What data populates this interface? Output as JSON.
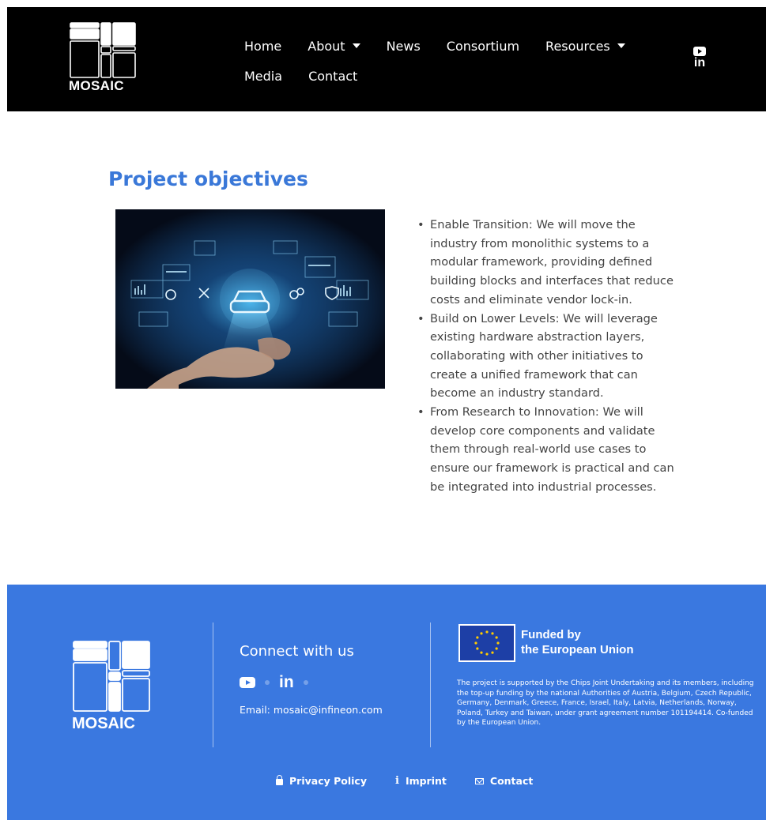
{
  "header": {
    "logo_text": "MOSAIC",
    "nav": [
      {
        "label": "Home",
        "has_dropdown": false
      },
      {
        "label": "About",
        "has_dropdown": true
      },
      {
        "label": "News",
        "has_dropdown": false
      },
      {
        "label": "Consortium",
        "has_dropdown": false
      },
      {
        "label": "Resources",
        "has_dropdown": true
      },
      {
        "label": "Media",
        "has_dropdown": false
      },
      {
        "label": "Contact",
        "has_dropdown": false
      }
    ],
    "social": {
      "youtube_icon": "youtube-icon",
      "linkedin_label": "in"
    }
  },
  "main": {
    "title": "Project objectives",
    "bullets": [
      "Enable Transition: We will move the industry from monolithic systems to a modular framework, providing defined building blocks and interfaces that reduce costs and eliminate vendor lock-in.",
      "Build on Lower Levels: We will leverage existing hardware abstraction layers, collaborating with other initiatives to create a unified framework that can become an industry standard.",
      "From Research to Innovation: We will develop core components and validate them through real-world use cases to ensure our framework is practical and can be integrated into industrial processes."
    ]
  },
  "footer": {
    "logo_text": "MOSAIC",
    "connect_title": "Connect with us",
    "linkedin_label": "in",
    "email": "Email: mosaic@infineon.com",
    "eu_title_line1": "Funded by",
    "eu_title_line2": "the European Union",
    "eu_text": "The project is supported by the Chips Joint Undertaking and its members, including the top-up funding by the national Authorities of Austria, Belgium, Czech Republic, Germany, Denmark, Greece, France, Israel, Italy, Latvia, Netherlands, Norway, Poland, Turkey and Taiwan, under grant agreement number 101194414. Co-funded by the European Union.",
    "links": {
      "privacy": "Privacy Policy",
      "imprint": "Imprint",
      "contact": "Contact"
    }
  },
  "colors": {
    "accent": "#3a78d8",
    "footer_bg": "#3a78e0",
    "header_bg": "#000000"
  }
}
